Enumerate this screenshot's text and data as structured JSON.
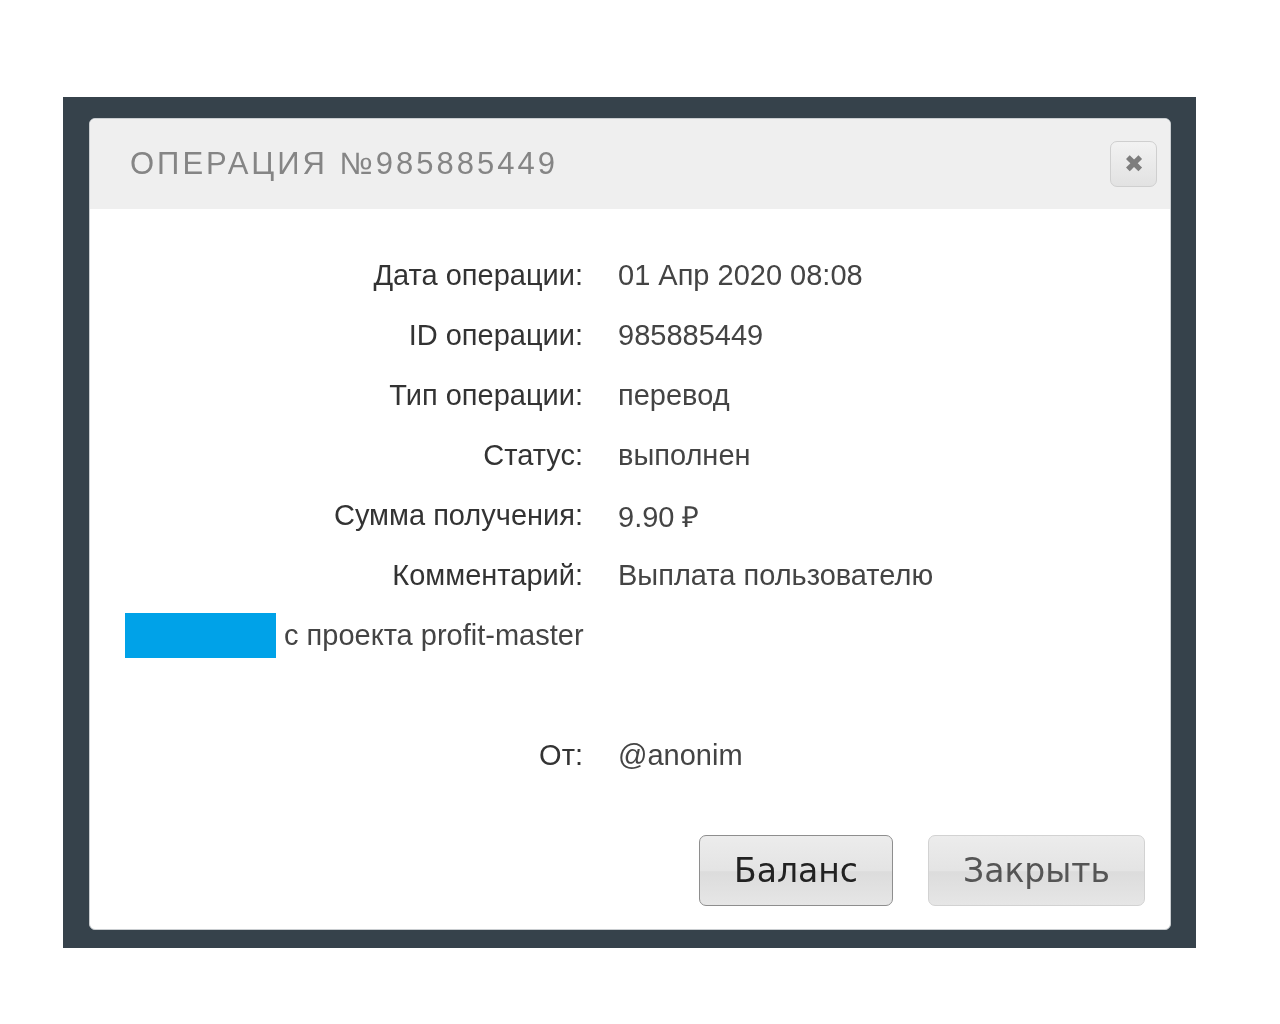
{
  "dialog": {
    "title": "ОПЕРАЦИЯ №985885449",
    "close_icon": "✖",
    "fields": [
      {
        "label": "Дата операции:",
        "value": "01 Апр 2020 08:08"
      },
      {
        "label": "ID операции:",
        "value": "985885449"
      },
      {
        "label": "Тип операции:",
        "value": "перевод"
      },
      {
        "label": "Статус:",
        "value": "выполнен"
      },
      {
        "label": "Сумма получения:",
        "value": "9.90 ₽"
      },
      {
        "label": "Комментарий:",
        "value": "Выплата пользователю"
      }
    ],
    "comment_continuation": "с проекта profit-master",
    "sender": {
      "label": "От:",
      "value": "@anonim"
    },
    "buttons": [
      {
        "label": "Баланс",
        "kind": "primary"
      },
      {
        "label": "Закрыть",
        "kind": "secondary"
      }
    ]
  }
}
